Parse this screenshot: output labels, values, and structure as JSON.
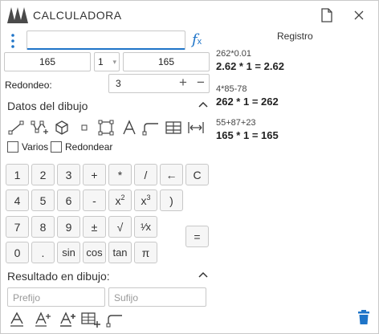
{
  "window": {
    "title": "CALCULADORA"
  },
  "input": {
    "expression": "",
    "fx_label": "f",
    "fx_sub": "x"
  },
  "numbers": {
    "left_value": "165",
    "selector_value": "1",
    "right_value": "165"
  },
  "rounding": {
    "label": "Redondeo:",
    "value": "3",
    "plus": "+",
    "minus": "−"
  },
  "drawing_data": {
    "section_title": "Datos del dibujo",
    "tool_icons": [
      "line-icon",
      "polyline-icon",
      "cube-icon",
      "point-icon",
      "bounding-box-icon",
      "text-icon",
      "leader-icon",
      "table-icon",
      "dimension-icon"
    ],
    "checkbox_various": "Varios",
    "checkbox_round": "Redondear"
  },
  "keypad": {
    "row1": [
      "1",
      "2",
      "3",
      "+",
      "*",
      "/",
      "←",
      "C"
    ],
    "row2": [
      "4",
      "5",
      "6",
      "-",
      "x",
      "x",
      ")"
    ],
    "row2_sup": [
      "2",
      "3"
    ],
    "open_paren": "(",
    "row3": [
      "7",
      "8",
      "9",
      "±",
      "√",
      "¹⁄x"
    ],
    "row4": [
      "0",
      ".",
      "sin",
      "cos",
      "tan",
      "π"
    ],
    "equals": "="
  },
  "result_in_drawing": {
    "section_title": "Resultado en dibujo:",
    "prefix_placeholder": "Prefijo",
    "suffix_placeholder": "Sufijo",
    "tool_icons": [
      "text-insert-icon",
      "text-add-icon",
      "text-plus-icon",
      "table-add-icon",
      "leader-icon"
    ]
  },
  "history": {
    "title": "Registro",
    "entries": [
      {
        "expression": "262*0.01",
        "result": "2.62 * 1 = 2.62"
      },
      {
        "expression": "4*85-78",
        "result": "262 * 1 = 262"
      },
      {
        "expression": "55+87+23",
        "result": "165 * 1 = 165"
      }
    ]
  },
  "colors": {
    "accent": "#1e74c8",
    "trash": "#1e74c8"
  }
}
